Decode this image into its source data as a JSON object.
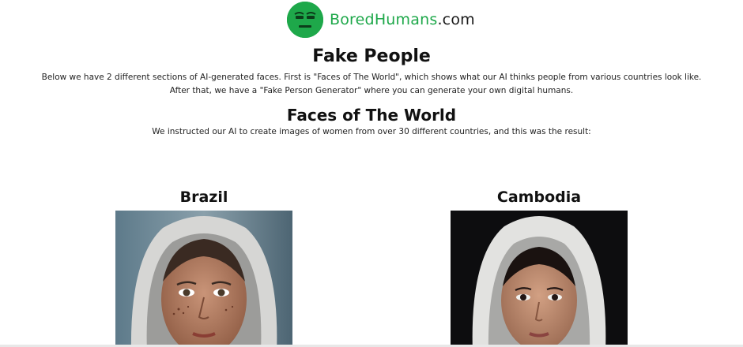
{
  "header": {
    "logo_icon": "smiling-face-icon",
    "brand_first": "Bored",
    "brand_second": "Humans",
    "brand_suffix": ".com",
    "brand_color": "#1ea84a"
  },
  "main": {
    "title": "Fake People",
    "intro_line1": "Below we have 2 different sections of AI-generated faces. First is \"Faces of The World\", which shows what our AI thinks people from various countries look like.",
    "intro_line2": "After that, we have a \"Fake Person Generator\" where you can generate your own digital humans.",
    "section_title": "Faces of The World",
    "section_desc": "We instructed our AI to create images of women from over 30 different countries, and this was the result:"
  },
  "faces": [
    {
      "country": "Brazil"
    },
    {
      "country": "Cambodia"
    }
  ]
}
